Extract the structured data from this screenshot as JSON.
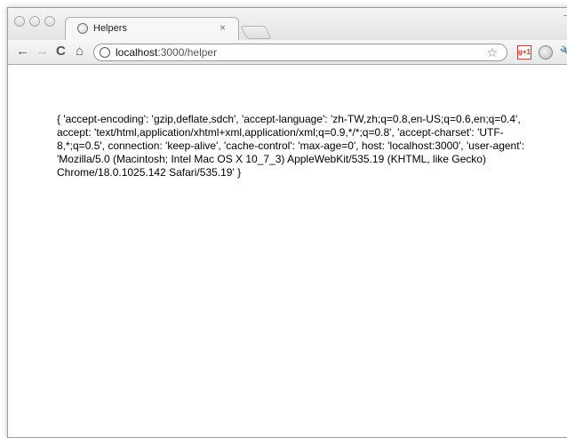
{
  "tab": {
    "title": "Helpers",
    "close_symbol": "×"
  },
  "omnibox": {
    "url_host": "localhost",
    "url_rest": ":3000/helper"
  },
  "toolbar": {
    "back_symbol": "←",
    "forward_symbol": "→",
    "reload_symbol": "C",
    "home_symbol": "⌂",
    "star_symbol": "☆",
    "gplus_text": "g+1",
    "wrench_symbol": "🔧"
  },
  "icons": {
    "tab_favicon": "globe-icon",
    "omnibox_icon": "globe-icon",
    "star": "star-icon",
    "extension1": "google-plus-one-icon",
    "extension2": "globe-extension-icon",
    "menu": "wrench-icon"
  },
  "page": {
    "headers_text": "{ 'accept-encoding': 'gzip,deflate,sdch', 'accept-language': 'zh-TW,zh;q=0.8,en-US;q=0.6,en;q=0.4', accept: 'text/html,application/xhtml+xml,application/xml;q=0.9,*/*;q=0.8', 'accept-charset': 'UTF-8,*;q=0.5', connection: 'keep-alive', 'cache-control': 'max-age=0', host: 'localhost:3000', 'user-agent': 'Mozilla/5.0 (Macintosh; Intel Mac OS X 10_7_3) AppleWebKit/535.19 (KHTML, like Gecko) Chrome/18.0.1025.142 Safari/535.19' }"
  }
}
